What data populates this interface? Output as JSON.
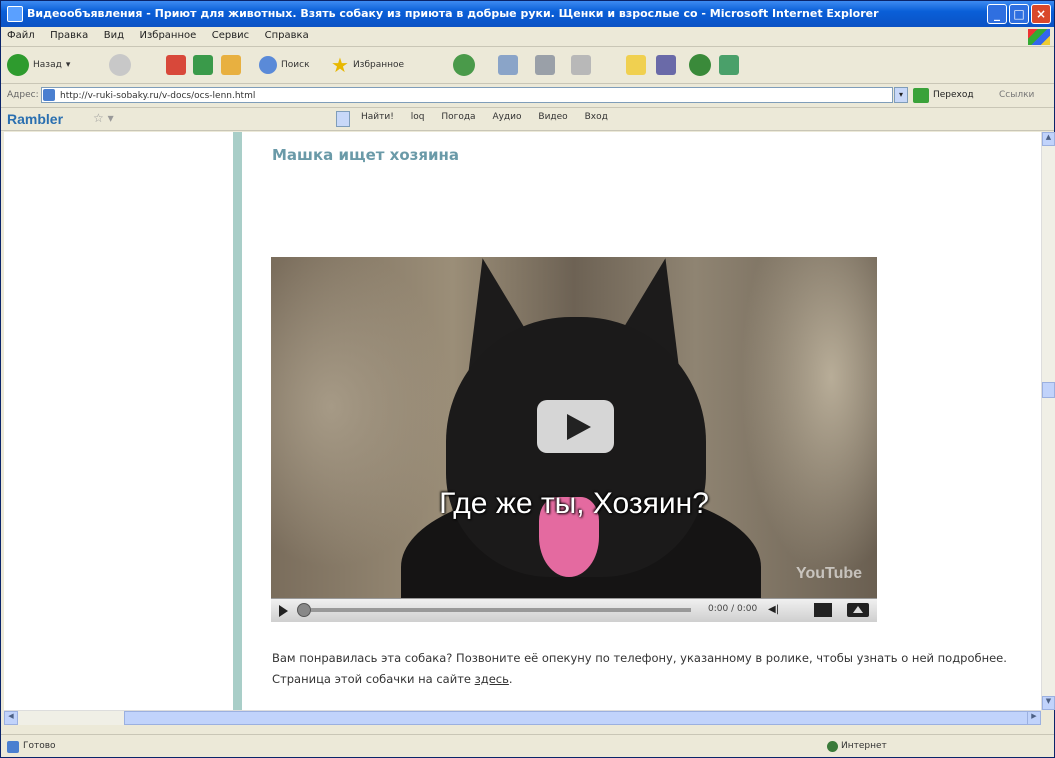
{
  "window": {
    "title": "Видеообъявления - Приют для животных. Взять собаку из приюта в добрые руки. Щенки и взрослые со - Microsoft Internet Explorer"
  },
  "menubar": [
    "Файл",
    "Правка",
    "Вид",
    "Избранное",
    "Сервис",
    "Справка"
  ],
  "toolbar": {
    "back_label": "Назад",
    "search_label": "Поиск",
    "favorites_label": "Избранное"
  },
  "address": {
    "label": "Адрес:",
    "url": "http://v-ruki-sobaky.ru/v-docs/ocs-lenn.html",
    "go_label": "Переход",
    "links_label": "Ссылки"
  },
  "rambler": {
    "logo": "Rambler",
    "items": [
      "Найти!",
      "loq",
      "Погода",
      "Аудио",
      "Видео",
      "Вход"
    ]
  },
  "page": {
    "heading": "Машка ищет хозяина",
    "video": {
      "caption": "Где же ты, Хозяин?",
      "watermark": "YouTube",
      "time": "0:00 / 0:00"
    },
    "description_text": "Вам понравилась эта собака? Позвоните её опекуну по телефону, указанному в ролике, чтобы узнать о ней подробнее. Страница этой собачки на сайте ",
    "description_link": "здесь",
    "description_end": "."
  },
  "status": {
    "text": "Готово",
    "zone": "Интернет"
  }
}
